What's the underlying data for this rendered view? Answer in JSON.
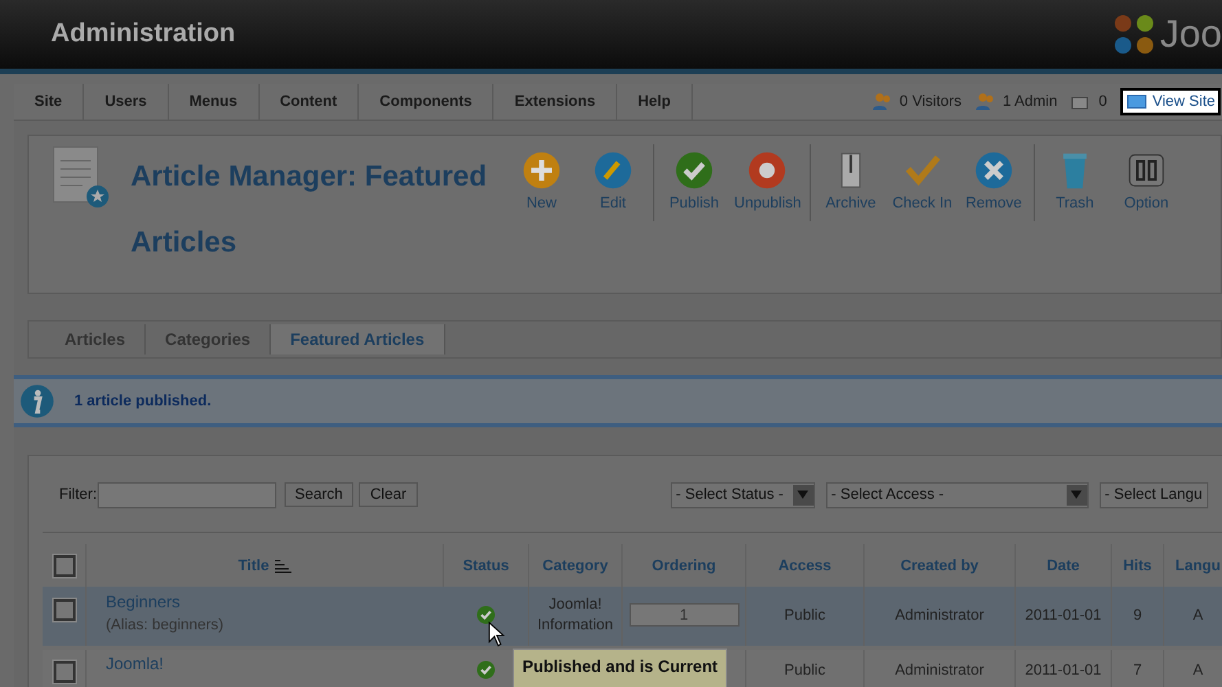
{
  "header": {
    "title": "Administration",
    "logo_text": "Joo"
  },
  "menu": {
    "items": [
      "Site",
      "Users",
      "Menus",
      "Content",
      "Components",
      "Extensions",
      "Help"
    ],
    "status": [
      {
        "kind": "visitors",
        "text": "0 Visitors"
      },
      {
        "kind": "admins",
        "text": "1 Admin"
      },
      {
        "kind": "messages",
        "text": "0"
      }
    ],
    "view_site": {
      "label": "View Site",
      "highlighted": true
    }
  },
  "toolbar": {
    "title": "Article Manager: Featured Articles",
    "groups": [
      [
        {
          "kind": "new",
          "label": "New"
        },
        {
          "kind": "edit",
          "label": "Edit"
        }
      ],
      [
        {
          "kind": "publish",
          "label": "Publish"
        },
        {
          "kind": "unpublish",
          "label": "Unpublish"
        }
      ],
      [
        {
          "kind": "archive",
          "label": "Archive"
        },
        {
          "kind": "checkin",
          "label": "Check In"
        },
        {
          "kind": "remove",
          "label": "Remove"
        }
      ],
      [
        {
          "kind": "trash",
          "label": "Trash"
        },
        {
          "kind": "options",
          "label": "Option"
        }
      ]
    ]
  },
  "subnav": [
    {
      "label": "Articles",
      "selected": false
    },
    {
      "label": "Categories",
      "selected": false
    },
    {
      "label": "Featured Articles",
      "selected": true
    }
  ],
  "message": "1 article published.",
  "filter": {
    "label": "Filter:",
    "buttons": [
      "Search",
      "Clear"
    ],
    "selects": [
      "- Select Status -",
      "- Select Access -",
      "- Select Langu"
    ]
  },
  "table": {
    "all_checked": false,
    "columns": [
      {
        "label": "Title",
        "sorted": true
      },
      {
        "label": "Status",
        "sorted": false
      },
      {
        "label": "Category",
        "sorted": false
      },
      {
        "label": "Ordering",
        "sorted": false
      },
      {
        "label": "Access",
        "sorted": false
      },
      {
        "label": "Created by",
        "sorted": false
      },
      {
        "label": "Date",
        "sorted": false
      },
      {
        "label": "Hits",
        "sorted": false
      },
      {
        "label": "Langu",
        "sorted": false
      }
    ],
    "rows": [
      {
        "selected": true,
        "checked": false,
        "title": "Beginners",
        "alias": "(Alias: beginners)",
        "published": true,
        "category": "Joomla! Information",
        "ordering": "1",
        "access": "Public",
        "created_by": "Administrator",
        "date": "2011-01-01",
        "hits": "9",
        "language": "A"
      },
      {
        "selected": false,
        "checked": false,
        "title": "Joomla!",
        "published": true,
        "access": "Public",
        "created_by": "Administrator",
        "date": "2011-01-01",
        "hits": "7",
        "language": "A"
      }
    ]
  },
  "tooltip": {
    "title": "Published and is Current"
  }
}
